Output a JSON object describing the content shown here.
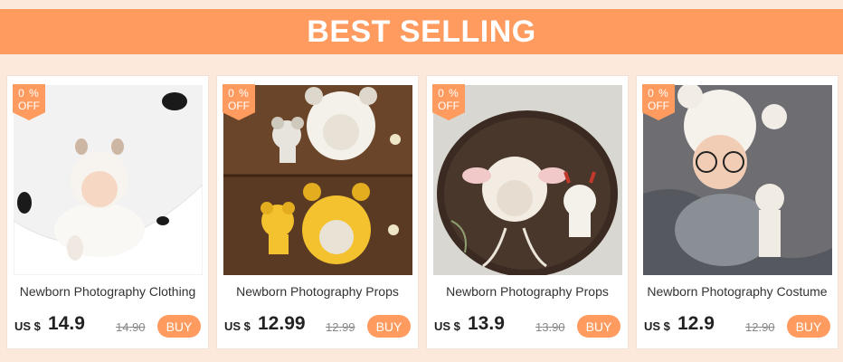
{
  "banner": {
    "title": "BEST SELLING"
  },
  "colors": {
    "accent": "#ff9b5f",
    "page_bg": "#fde9dc"
  },
  "products": [
    {
      "title": "Newborn Photography Clothing",
      "currency": "US $",
      "price": "14.9",
      "old_price": "14.90",
      "discount_pct": "0 %",
      "discount_off": "OFF",
      "buy_label": "BUY"
    },
    {
      "title": "Newborn Photography Props",
      "currency": "US $",
      "price": "12.99",
      "old_price": "12.99",
      "discount_pct": "0 %",
      "discount_off": "OFF",
      "buy_label": "BUY"
    },
    {
      "title": "Newborn Photography Props",
      "currency": "US $",
      "price": "13.9",
      "old_price": "13.90",
      "discount_pct": "0 %",
      "discount_off": "OFF",
      "buy_label": "BUY"
    },
    {
      "title": "Newborn Photography Costume",
      "currency": "US $",
      "price": "12.9",
      "old_price": "12.90",
      "discount_pct": "0 %",
      "discount_off": "OFF",
      "buy_label": "BUY"
    }
  ]
}
